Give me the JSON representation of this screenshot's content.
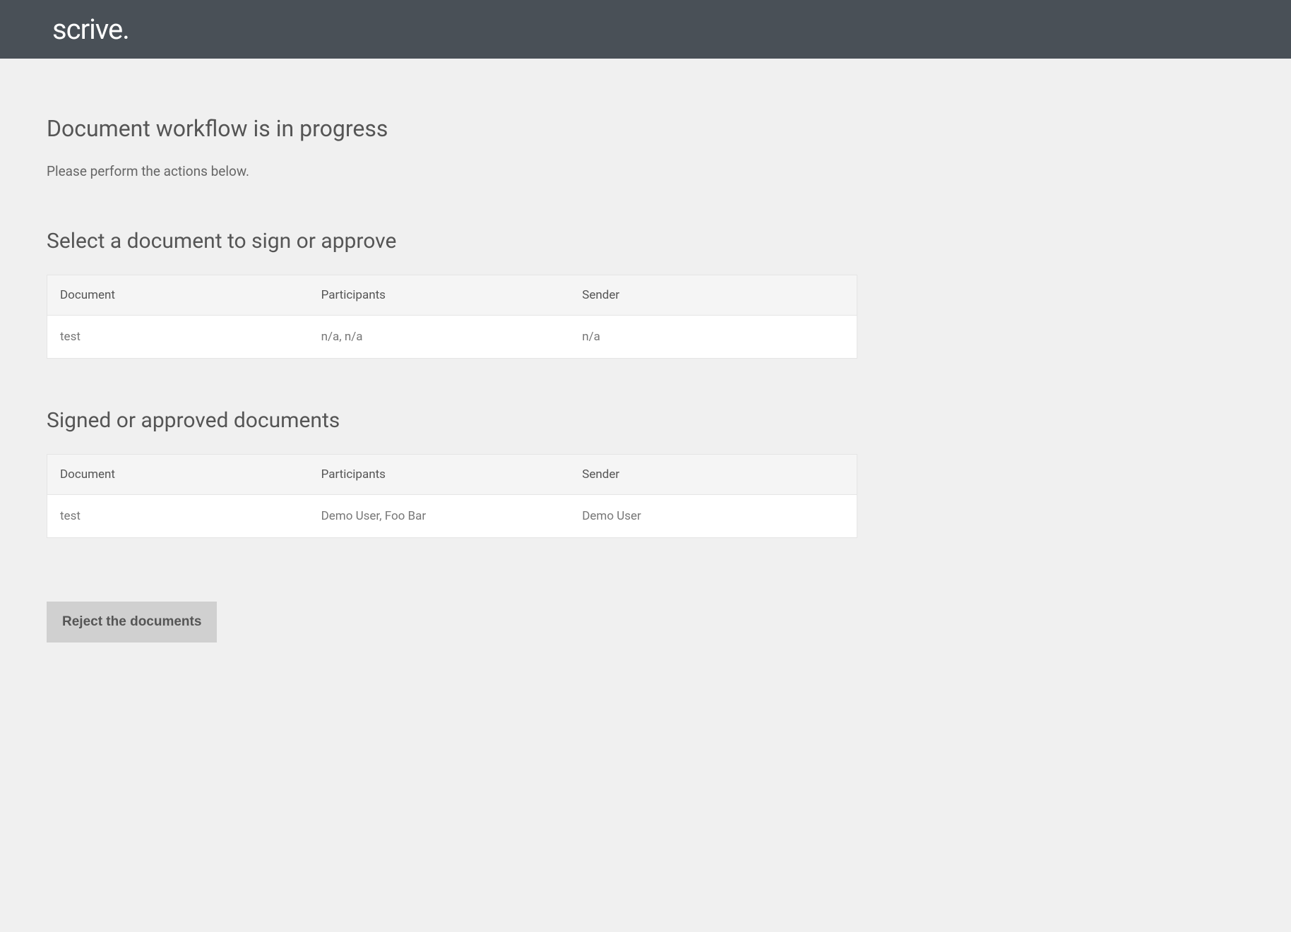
{
  "header": {
    "logo": "scrive."
  },
  "page": {
    "title": "Document workflow is in progress",
    "subtitle": "Please perform the actions below."
  },
  "pending_section": {
    "title": "Select a document to sign or approve",
    "columns": {
      "document": "Document",
      "participants": "Participants",
      "sender": "Sender"
    },
    "rows": [
      {
        "document": "test",
        "participants": "n/a, n/a",
        "sender": "n/a"
      }
    ]
  },
  "signed_section": {
    "title": "Signed or approved documents",
    "columns": {
      "document": "Document",
      "participants": "Participants",
      "sender": "Sender"
    },
    "rows": [
      {
        "document": "test",
        "participants": "Demo User, Foo Bar",
        "sender": "Demo User"
      }
    ]
  },
  "actions": {
    "reject_label": "Reject the documents"
  }
}
